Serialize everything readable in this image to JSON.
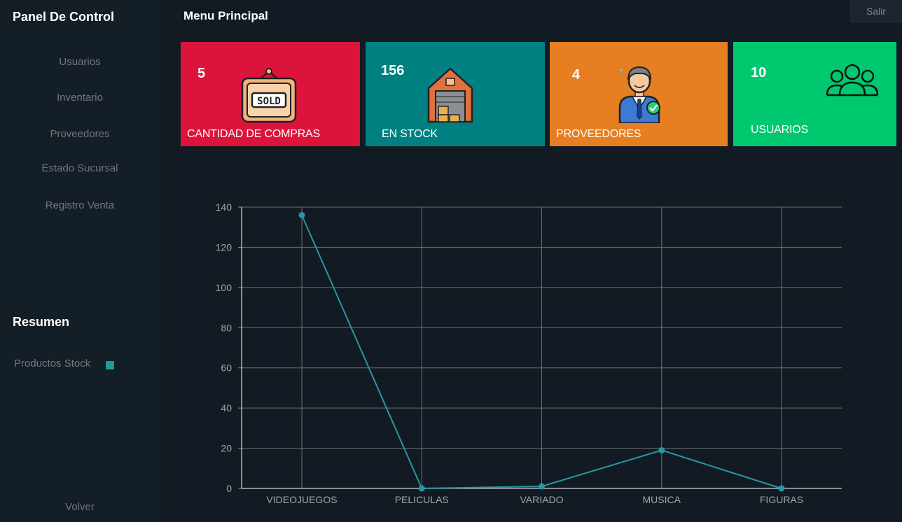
{
  "sidebar": {
    "title": "Panel De Control",
    "items": [
      {
        "label": "Usuarios"
      },
      {
        "label": "Inventario"
      },
      {
        "label": "Proveedores"
      },
      {
        "label": "Estado Sucursal"
      },
      {
        "label": "Registro Venta"
      }
    ],
    "summary_title": "Resumen",
    "legend_label": "Productos Stock",
    "back_label": "Volver"
  },
  "header": {
    "title": "Menu Principal",
    "logout_label": "Salir"
  },
  "cards": [
    {
      "value": "5",
      "label": "CANTIDAD DE COMPRAS",
      "color": "#dc143c",
      "icon": "sold-sign-icon"
    },
    {
      "value": "156",
      "label": "EN STOCK",
      "color": "#008080",
      "icon": "warehouse-icon"
    },
    {
      "value": "4",
      "label": "PROVEEDORES",
      "color": "#e67e22",
      "icon": "supplier-icon"
    },
    {
      "value": "10",
      "label": "USUARIOS",
      "color": "#00c86e",
      "icon": "users-icon"
    }
  ],
  "chart_data": {
    "type": "line",
    "categories": [
      "VIDEOJUEGOS",
      "PELICULAS",
      "VARIADO",
      "MUSICA",
      "FIGURAS"
    ],
    "series": [
      {
        "name": "Productos Stock",
        "values": [
          136,
          0,
          1,
          19,
          0
        ],
        "color": "#2a95a5"
      }
    ],
    "ylim": [
      0,
      140
    ],
    "yticks": [
      "0",
      "20",
      "40",
      "60",
      "80",
      "100",
      "120",
      "140"
    ],
    "grid": true
  }
}
